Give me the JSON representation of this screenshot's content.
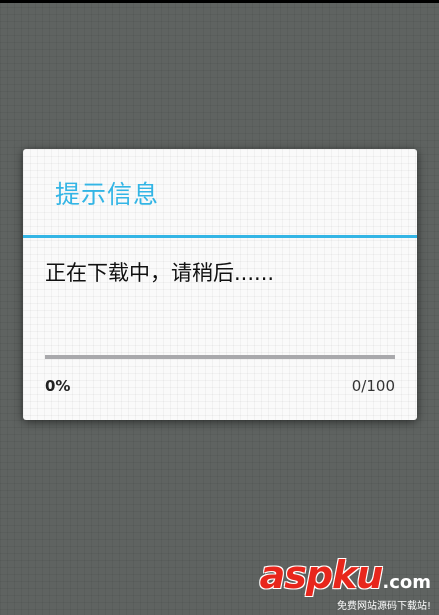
{
  "dialog": {
    "title": "提示信息",
    "message": "正在下载中，请稍后......",
    "progress": {
      "value": 0,
      "max": 100,
      "percent_label": "0%",
      "count_label": "0/100"
    }
  },
  "colors": {
    "accent": "#33b5e5",
    "backdrop": "#5f6361",
    "dialog_background": "#fafafa",
    "progress_track": "#a9a9ac"
  },
  "watermark": {
    "logo": "aspku",
    "tld": ".com",
    "tagline": "免费网站源码下载站!"
  }
}
